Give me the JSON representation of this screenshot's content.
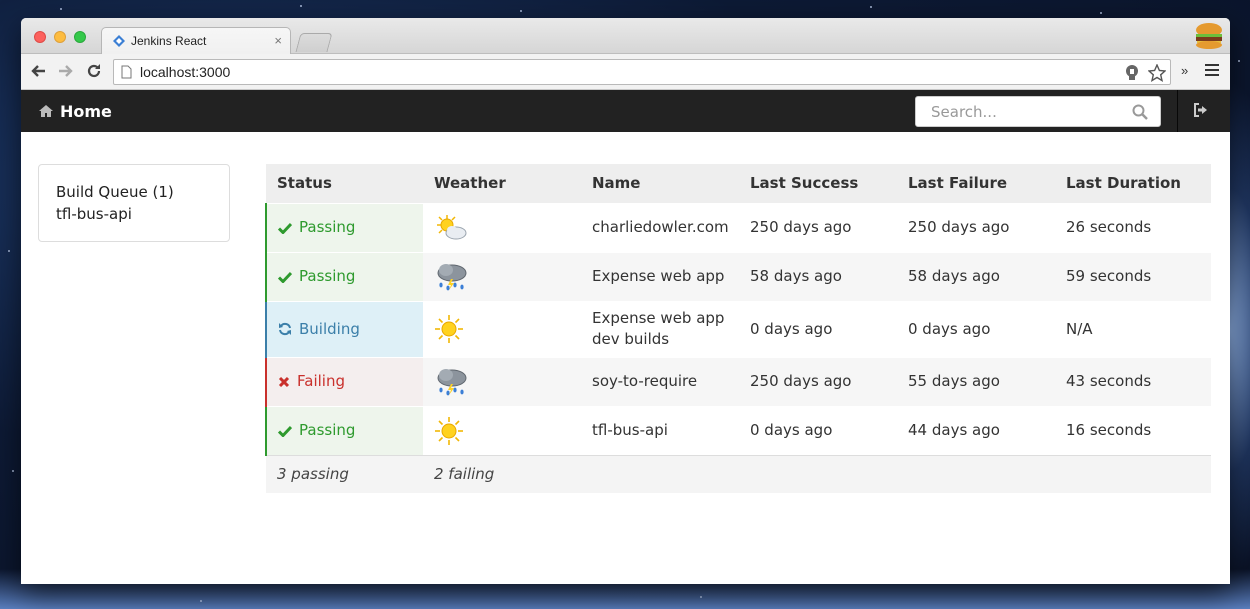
{
  "browser": {
    "tab_title": "Jenkins React",
    "tab_close": "×",
    "url": "localhost:3000",
    "overflow_chevron": "»"
  },
  "navbar": {
    "home_label": "Home",
    "search_placeholder": "Search..."
  },
  "build_queue": {
    "title": "Build Queue (1)",
    "items": [
      "tfl-bus-api"
    ]
  },
  "jobs_table": {
    "headers": {
      "status": "Status",
      "weather": "Weather",
      "name": "Name",
      "last_success": "Last Success",
      "last_failure": "Last Failure",
      "last_duration": "Last Duration"
    },
    "rows": [
      {
        "status": "Passing",
        "status_icon": "check-icon",
        "weather": "partly-cloudy-icon",
        "name": "charliedowler.com",
        "last_success": "250 days ago",
        "last_failure": "250 days ago",
        "last_duration": "26 seconds"
      },
      {
        "status": "Passing",
        "status_icon": "check-icon",
        "weather": "rain-cloud-icon",
        "name": "Expense web app",
        "last_success": "58 days ago",
        "last_failure": "58 days ago",
        "last_duration": "59 seconds"
      },
      {
        "status": "Building",
        "status_icon": "refresh-icon",
        "weather": "sun-icon",
        "name": "Expense web app dev builds",
        "last_success": "0 days ago",
        "last_failure": "0 days ago",
        "last_duration": "N/A"
      },
      {
        "status": "Failing",
        "status_icon": "cross-icon",
        "weather": "rain-cloud-icon",
        "name": "soy-to-require",
        "last_success": "250 days ago",
        "last_failure": "55 days ago",
        "last_duration": "43 seconds"
      },
      {
        "status": "Passing",
        "status_icon": "check-icon",
        "weather": "sun-icon",
        "name": "tfl-bus-api",
        "last_success": "0 days ago",
        "last_failure": "44 days ago",
        "last_duration": "16 seconds"
      }
    ],
    "footer": {
      "passing": "3 passing",
      "failing": "2 failing"
    }
  },
  "colors": {
    "passing": "#2e9a2e",
    "building": "#3b7fa9",
    "failing": "#c9302c",
    "navbar_bg": "#222222"
  }
}
